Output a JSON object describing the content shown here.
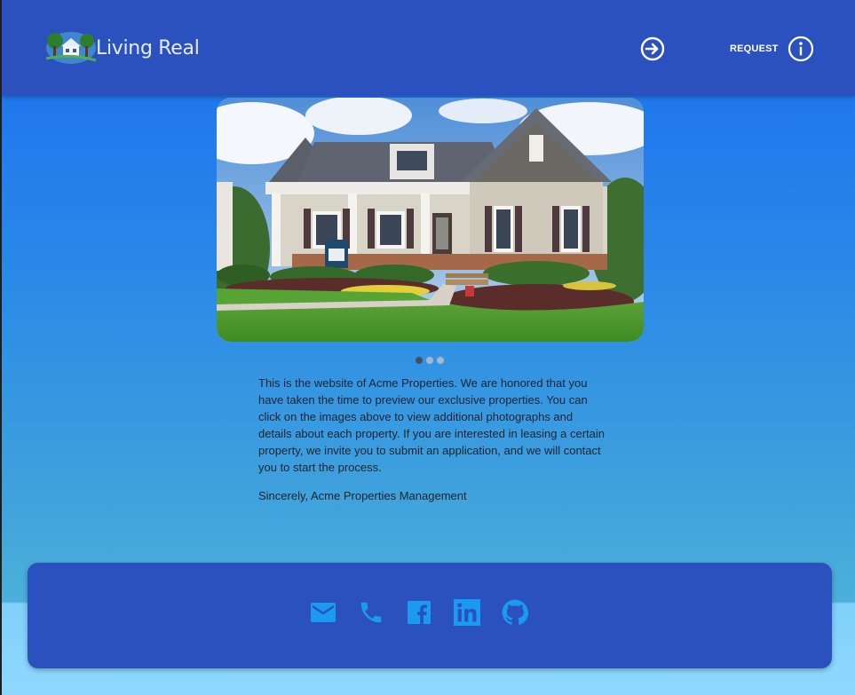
{
  "header": {
    "brand": "Living Real",
    "login_icon": "login-arrow-icon",
    "request_label": "REQUEST",
    "request_icon": "info-icon"
  },
  "carousel": {
    "slide_count": 3,
    "active_index": 0
  },
  "intro": {
    "paragraph": "This is the website of Acme Properties. We are honored that you have taken the time to preview our exclusive properties. You can click on the images above to view additional photographs and details about each property. If you are interested in leasing a certain property, we invite you to submit an application, and we will contact you to start the process.",
    "signature": "Sincerely, Acme Properties Management"
  },
  "footer": {
    "icons": [
      "email-icon",
      "phone-icon",
      "facebook-icon",
      "linkedin-icon",
      "github-icon"
    ]
  },
  "colors": {
    "header_bg": "#2a51bd",
    "icon_blue": "#1b9af2",
    "text_dark": "#1c2330"
  }
}
